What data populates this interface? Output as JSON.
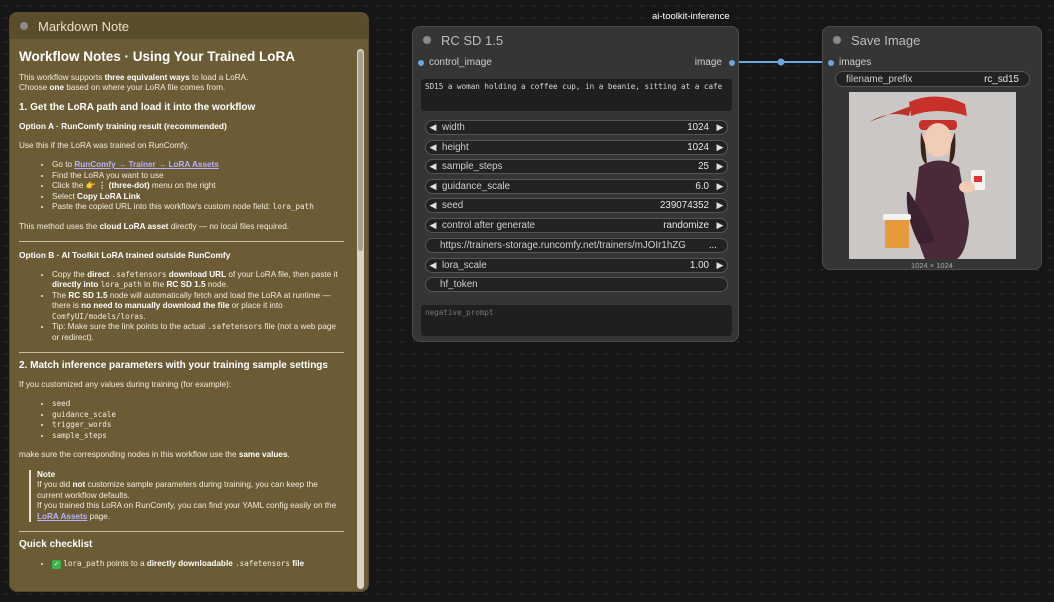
{
  "markdown_note": {
    "title": "Markdown Note",
    "heading": "Workflow Notes · Using Your Trained LoRA",
    "intro_1": "This workflow supports",
    "intro_1_bold": "three equivalent ways",
    "intro_1_end": "to load a LoRA.",
    "intro_2": "Choose",
    "intro_2_bold": "one",
    "intro_2_end": "based on where your LoRA file comes from.",
    "section1": "1. Get the LoRA path and load it into the workflow",
    "optionA": "Option A · RunComfy training result (recommended)",
    "optionA_desc": "Use this if the LoRA was trained on RunComfy.",
    "a_go_to": "Go to",
    "a_link": "RunComfy → Trainer → LoRA Assets",
    "a_find": "Find the LoRA you want to use",
    "a_click": "Click the",
    "a_click_icon": "👉",
    "a_click_bold": "⋮ (three-dot)",
    "a_click_end": "menu on the right",
    "a_select": "Select",
    "a_select_bold": "Copy LoRA Link",
    "a_paste": "Paste the copied URL into this workflow's custom node field:",
    "a_paste_code": "lora_path",
    "a_method_1": "This method uses the",
    "a_method_bold": "cloud LoRA asset",
    "a_method_2": "directly — no local files required.",
    "optionB": "Option B · AI Toolkit LoRA trained outside RunComfy",
    "b_copy_1": "Copy the",
    "b_copy_bold": "direct",
    "b_copy_code": ".safetensors",
    "b_copy_bold2": "download URL",
    "b_copy_2": "of your LoRA file, then paste it",
    "b_copy_bold3": "directly into",
    "b_copy_code2": "lora_path",
    "b_copy_3": "in the",
    "b_copy_bold4": "RC SD 1.5",
    "b_copy_4": "node.",
    "b_the": "The",
    "b_node_bold": "RC SD 1.5",
    "b_node_1": "node will automatically fetch and load the LoRA at runtime —",
    "b_node_2": "there is",
    "b_node_bold2": "no need to manually download the file",
    "b_node_3": "or place it into",
    "b_node_code": "ComfyUI/models/loras",
    "b_tip_1": "Tip: Make sure the link points to the actual",
    "b_tip_code": ".safetensors",
    "b_tip_2": "file (not a web page or redirect).",
    "section2": "2. Match inference parameters with your training sample settings",
    "s2_intro": "If you customized any values during training (for example):",
    "s2_items": [
      "seed",
      "guidance_scale",
      "trigger_words",
      "sample_steps"
    ],
    "s2_make_1": "make sure the corresponding nodes in this workflow use the",
    "s2_make_bold": "same values",
    "note_title": "Note",
    "note_1": "If you did",
    "note_1_bold": "not",
    "note_1_end": "customize sample parameters during training, you can keep the current workflow defaults.",
    "note_2": "If you trained this LoRA on RunComfy, you can find your YAML config easily on the",
    "note_2_link": "LoRA Assets",
    "note_2_end": "page.",
    "checklist": "Quick checklist",
    "check_1_code": "lora_path",
    "check_1_text": "points to a",
    "check_1_bold": "directly downloadable",
    "check_1_code2": ".safetensors",
    "check_1_end": "file"
  },
  "rc_node": {
    "title": "RC SD 1.5",
    "input_label": "control_image",
    "output_label": "image",
    "prompt": "SD15 a woman holding a coffee cup, in a beanie, sitting at a cafe",
    "widgets": [
      {
        "label": "width",
        "value": "1024",
        "arrows": true
      },
      {
        "label": "height",
        "value": "1024",
        "arrows": true
      },
      {
        "label": "sample_steps",
        "value": "25",
        "arrows": true
      },
      {
        "label": "guidance_scale",
        "value": "6.0",
        "arrows": true
      },
      {
        "label": "seed",
        "value": "239074352",
        "arrows": true
      },
      {
        "label": "control after generate",
        "value": "randomize",
        "arrows": true
      },
      {
        "label": "https://trainers-storage.runcomfy.net/trainers/mJOIr1hZG",
        "value": "...",
        "arrows": false
      },
      {
        "label": "lora_scale",
        "value": "1.00",
        "arrows": true
      },
      {
        "label": "hf_token",
        "value": "",
        "arrows": false
      }
    ],
    "negative_placeholder": "negative_prompt"
  },
  "group_label": "ai-toolkit-inference",
  "save_node": {
    "title": "Save Image",
    "input_label": "images",
    "filename_label": "filename_prefix",
    "filename_value": "rc_sd15",
    "image_dims": "1024 × 1024"
  },
  "colors": {
    "canvas": "#161616",
    "note_bg": "#6b5c36",
    "node_bg": "#353535",
    "link": "#6aa7e0",
    "link_text": "#b8b0ff"
  }
}
